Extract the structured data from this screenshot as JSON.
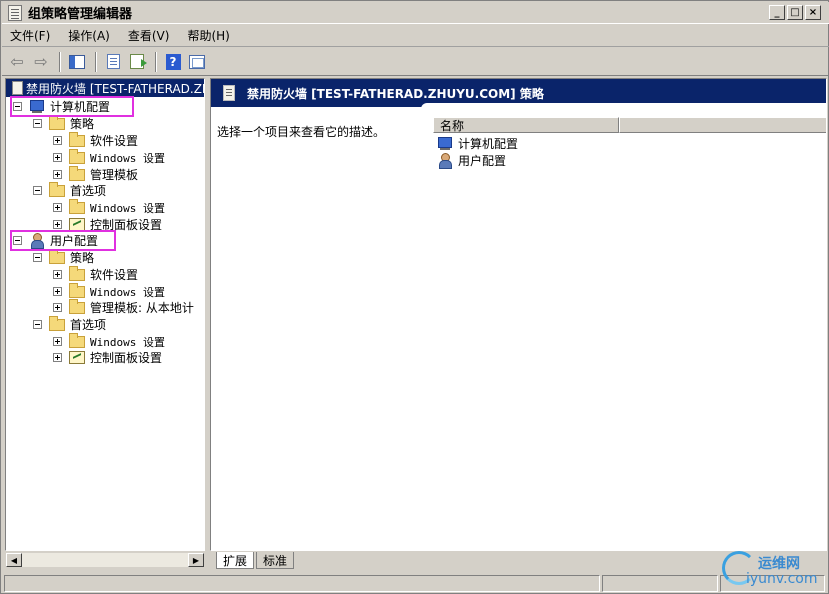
{
  "window": {
    "title": "组策略管理编辑器",
    "buttons": [
      "_",
      "□",
      "×"
    ]
  },
  "menubar": {
    "items": [
      "文件(F)",
      "操作(A)",
      "查看(V)",
      "帮助(H)"
    ]
  },
  "toolbar": {
    "icons": [
      "back-arrow-icon",
      "forward-arrow-icon",
      "show-tree-icon",
      "properties-icon",
      "export-list-icon",
      "help-icon",
      "view-icon"
    ]
  },
  "tree": {
    "root_label": "禁用防火墙 [TEST-FATHERAD.ZH",
    "computer_config": {
      "label": "计算机配置",
      "policy": {
        "label": "策略",
        "children": [
          "软件设置",
          "Windows 设置",
          "管理模板"
        ]
      },
      "preferences": {
        "label": "首选项",
        "children": [
          "Windows 设置",
          "控制面板设置"
        ]
      }
    },
    "user_config": {
      "label": "用户配置",
      "policy": {
        "label": "策略",
        "children": [
          "软件设置",
          "Windows 设置",
          "管理模板: 从本地计"
        ]
      },
      "preferences": {
        "label": "首选项",
        "children": [
          "Windows 设置",
          "控制面板设置"
        ]
      }
    }
  },
  "right_pane": {
    "header_title": "禁用防火墙 [TEST-FATHERAD.ZHUYU.COM] 策略",
    "description": "选择一个项目来查看它的描述。",
    "column_name": "名称",
    "items": [
      "计算机配置",
      "用户配置"
    ]
  },
  "tabs": {
    "extended": "扩展",
    "standard": "标准"
  },
  "watermark": {
    "cn": "运维网",
    "en": "iyunv.com"
  },
  "colors": {
    "highlight": "#e030e0",
    "selected_bg": "#0a246a"
  }
}
